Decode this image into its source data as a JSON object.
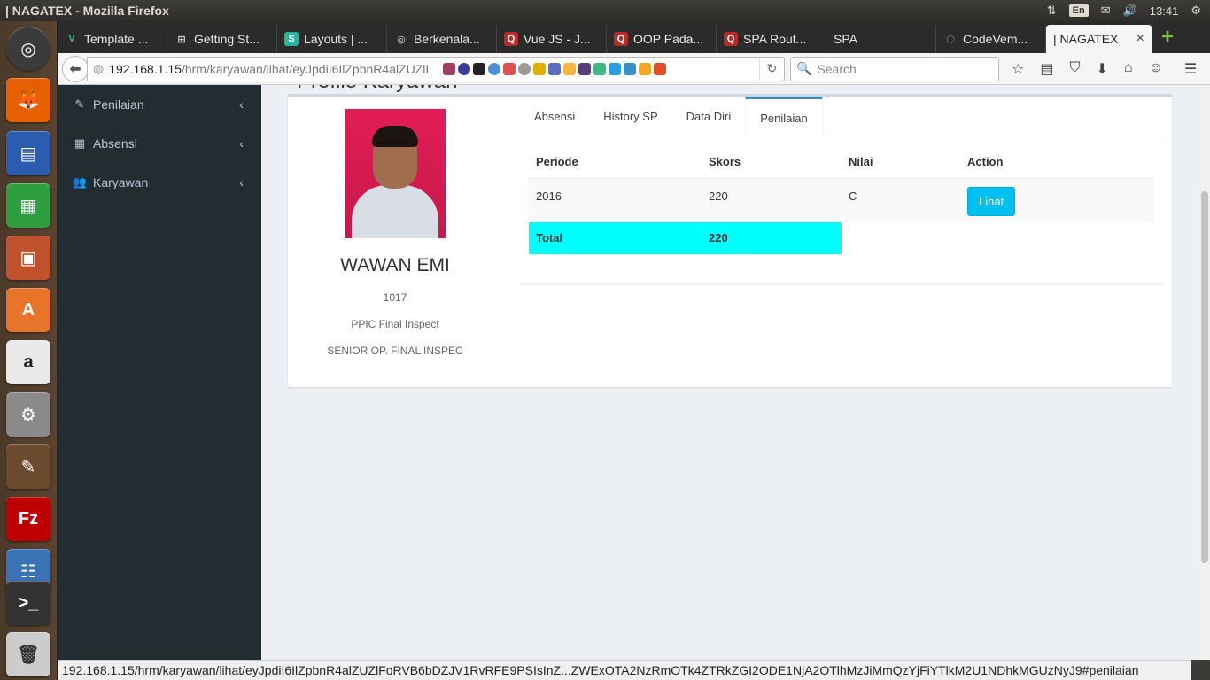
{
  "window": {
    "title": "| NAGATEX - Mozilla Firefox"
  },
  "tray": {
    "lang": "En",
    "clock": "13:41"
  },
  "tabs": [
    {
      "label": "Template ...",
      "fav": "V",
      "fav_color": "#41b883"
    },
    {
      "label": "Getting St...",
      "fav": "⊞",
      "fav_color": "#444444"
    },
    {
      "label": "Layouts | ...",
      "fav": "S",
      "fav_color": "#2bb39c"
    },
    {
      "label": "Berkenala...",
      "fav": "◎",
      "fav_color": "#333333"
    },
    {
      "label": "Vue JS - J...",
      "fav": "Q",
      "fav_color": "#b92b27"
    },
    {
      "label": "OOP Pada...",
      "fav": "Q",
      "fav_color": "#b92b27"
    },
    {
      "label": "SPA Rout...",
      "fav": "Q",
      "fav_color": "#b92b27"
    },
    {
      "label": "SPA",
      "fav": "",
      "fav_color": "#2b2b2b"
    },
    {
      "label": "CodeVem...",
      "fav": "⬡",
      "fav_color": "#444444"
    }
  ],
  "active_tab": {
    "label": "| NAGATEX",
    "close": "×"
  },
  "address": {
    "host": "192.168.1.15",
    "path": "/hrm/karyawan/lihat/eyJpdiI6IlZpbnR4alZUZlI",
    "search_placeholder": "Search"
  },
  "sidebar": {
    "items": [
      {
        "label": "Penilaian",
        "icon": "✎"
      },
      {
        "label": "Absensi",
        "icon": "▦"
      },
      {
        "label": "Karyawan",
        "icon": "👥"
      }
    ]
  },
  "page": {
    "heading": "Profile Karyawan"
  },
  "profile": {
    "name": "WAWAN EMI",
    "id": "1017",
    "department": "PPIC Final Inspect",
    "position": "SENIOR OP. FINAL INSPEC"
  },
  "profile_tabs": [
    "Absensi",
    "History SP",
    "Data Diri",
    "Penilaian"
  ],
  "table": {
    "headers": [
      "Periode",
      "Skors",
      "Nilai",
      "Action"
    ],
    "rows": [
      {
        "periode": "2016",
        "skors": "220",
        "nilai": "C",
        "action": "Lihat"
      }
    ],
    "total_label": "Total",
    "total_value": "220"
  },
  "status": {
    "url": "192.168.1.15/hrm/karyawan/lihat/eyJpdiI6IlZpbnR4alZUZlFoRVB6bDZJV1RvRFE9PSIsInZ...ZWExOTA2NzRmOTk4ZTRkZGI2ODE1NjA2OTlhMzJiMmQzYjFiYTlkM2U1NDhkMGUzNyJ9#penilaian"
  },
  "colors": {
    "sidebar_bg": "#222d32",
    "accent": "#3c8dbc",
    "button": "#00c0ef",
    "total_row": "#00ffff"
  }
}
